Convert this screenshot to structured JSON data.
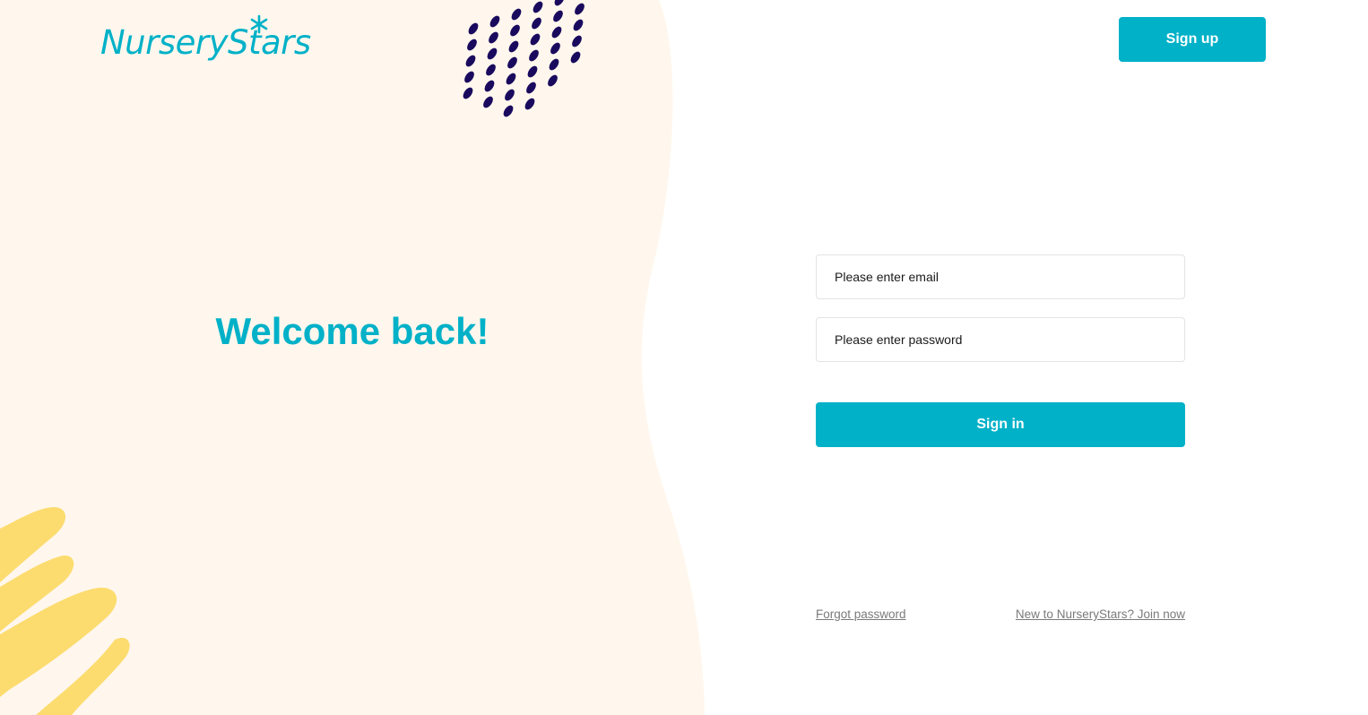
{
  "brand": {
    "name": "NurseryStars",
    "accent_color": "#00b1c8",
    "panel_color": "#fff7ed",
    "dots_color": "#1a0a5e",
    "scribble_color": "#fcdc6f"
  },
  "header": {
    "signup_label": "Sign up"
  },
  "hero": {
    "title": "Welcome back!"
  },
  "form": {
    "email_placeholder": "Please enter email",
    "password_placeholder": "Please enter password",
    "signin_label": "Sign in"
  },
  "footer_links": {
    "forgot_password": "Forgot password",
    "join": "New to NurseryStars? Join now"
  },
  "icons": {
    "logo_star": "asterisk-star-icon",
    "dots": "dots-pattern-decoration",
    "scribble": "yellow-scribble-decoration"
  }
}
